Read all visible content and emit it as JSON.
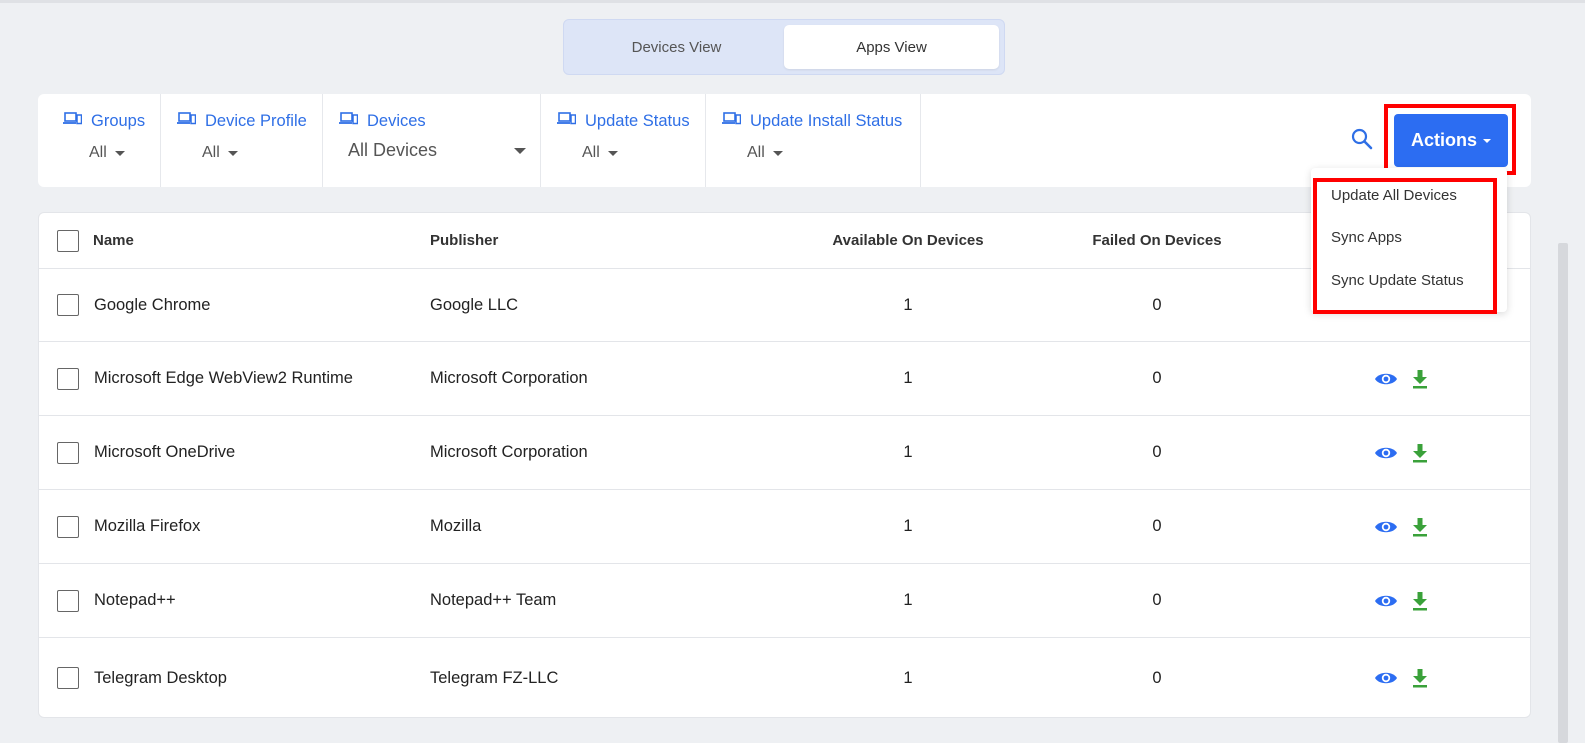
{
  "view_toggle": {
    "devices_view": "Devices View",
    "apps_view": "Apps View",
    "active": "Apps View"
  },
  "filters": [
    {
      "label": "Groups",
      "value": "All",
      "icon": "devices-icon"
    },
    {
      "label": "Device Profile",
      "value": "All",
      "icon": "devices-icon"
    },
    {
      "label": "Devices",
      "value": "All Devices",
      "icon": "devices-icon"
    },
    {
      "label": "Update Status",
      "value": "All",
      "icon": "devices-icon"
    },
    {
      "label": "Update Install Status",
      "value": "All",
      "icon": "devices-icon"
    }
  ],
  "toolbar": {
    "search_icon": "search-icon",
    "actions_label": "Actions"
  },
  "actions_menu": {
    "items": [
      "Update All Devices",
      "Sync Apps",
      "Sync Update Status"
    ]
  },
  "table": {
    "columns": {
      "name": "Name",
      "publisher": "Publisher",
      "available": "Available On Devices",
      "failed": "Failed On Devices"
    },
    "rows": [
      {
        "name": "Google Chrome",
        "publisher": "Google LLC",
        "available": "1",
        "failed": "0"
      },
      {
        "name": "Microsoft Edge WebView2 Runtime",
        "publisher": "Microsoft Corporation",
        "available": "1",
        "failed": "0"
      },
      {
        "name": "Microsoft OneDrive",
        "publisher": "Microsoft Corporation",
        "available": "1",
        "failed": "0"
      },
      {
        "name": "Mozilla Firefox",
        "publisher": "Mozilla",
        "available": "1",
        "failed": "0"
      },
      {
        "name": "Notepad++",
        "publisher": "Notepad++ Team",
        "available": "1",
        "failed": "0"
      },
      {
        "name": "Telegram Desktop",
        "publisher": "Telegram FZ-LLC",
        "available": "1",
        "failed": "0"
      }
    ],
    "row_icons": [
      "eye-icon",
      "download-icon"
    ]
  },
  "colors": {
    "accent": "#2c6df2",
    "link": "#2f6fe6",
    "download": "#3aa13a",
    "highlight": "#ff0000"
  }
}
